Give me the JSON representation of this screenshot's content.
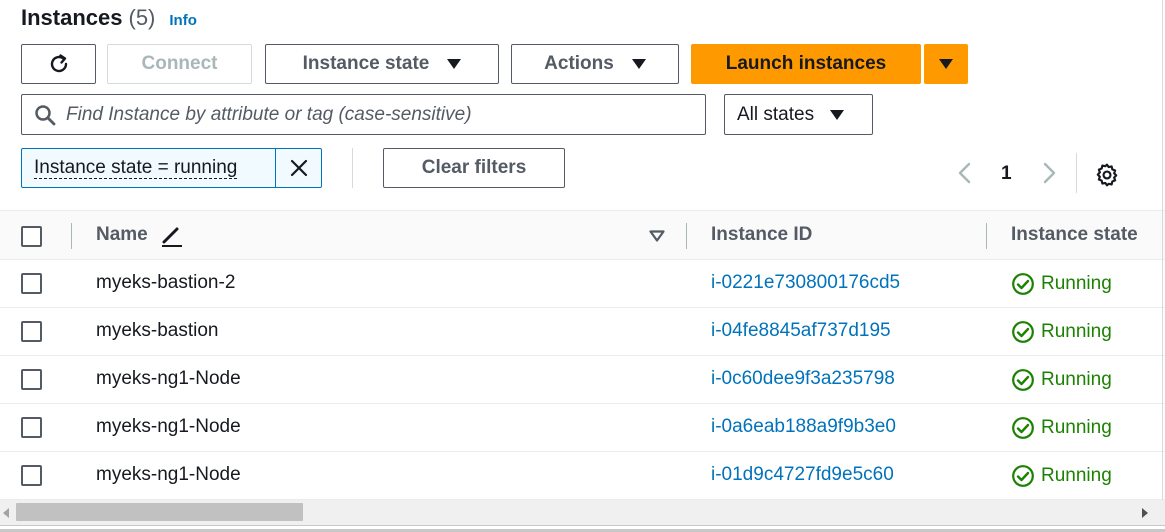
{
  "header": {
    "title": "Instances",
    "count": "(5)",
    "info": "Info"
  },
  "toolbar": {
    "connect": "Connect",
    "instance_state": "Instance state",
    "actions": "Actions",
    "launch": "Launch instances"
  },
  "search": {
    "placeholder": "Find Instance by attribute or tag (case-sensitive)"
  },
  "state_filter": {
    "selected": "All states"
  },
  "filter_token": {
    "label": "Instance state = running"
  },
  "clear_filters": "Clear filters",
  "pagination": {
    "current_page": "1"
  },
  "table": {
    "columns": {
      "name": "Name",
      "instance_id": "Instance ID",
      "instance_state": "Instance state"
    },
    "rows": [
      {
        "name": "myeks-bastion-2",
        "instance_id": "i-0221e730800176cd5",
        "state": "Running"
      },
      {
        "name": "myeks-bastion",
        "instance_id": "i-04fe8845af737d195",
        "state": "Running"
      },
      {
        "name": "myeks-ng1-Node",
        "instance_id": "i-0c60dee9f3a235798",
        "state": "Running"
      },
      {
        "name": "myeks-ng1-Node",
        "instance_id": "i-0a6eab188a9f9b3e0",
        "state": "Running"
      },
      {
        "name": "myeks-ng1-Node",
        "instance_id": "i-01d9c4727fd9e5c60",
        "state": "Running"
      }
    ]
  },
  "colors": {
    "primary": "#ff9900",
    "link": "#0073bb",
    "success": "#1d8102",
    "border": "#545b64"
  },
  "icons": [
    "refresh-icon",
    "caret-down-icon",
    "search-icon",
    "close-icon",
    "chevron-left-icon",
    "chevron-right-icon",
    "gear-icon",
    "edit-icon",
    "sort-icon",
    "status-ok-icon"
  ]
}
